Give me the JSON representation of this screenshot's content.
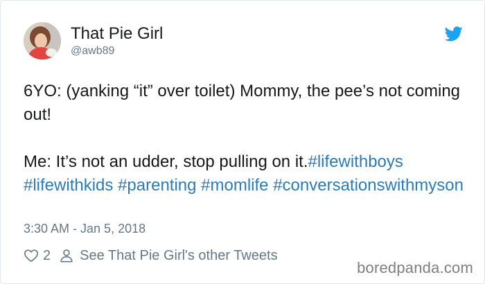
{
  "user": {
    "display_name": "That Pie Girl",
    "handle": "@awb89"
  },
  "tweet": {
    "line1": "6YO: (yanking “it” over toilet) Mommy, the pee’s not coming out!",
    "line2": "Me: It’s not an udder, stop pulling on it.",
    "hashtags": [
      "#lifewithboys",
      "#lifewithkids",
      "#parenting",
      "#momlife",
      "#conversationswithmyson"
    ],
    "timestamp": "3:30 AM - Jan 5, 2018"
  },
  "actions": {
    "like_count": "2",
    "other_tweets_label": "See That Pie Girl's other Tweets"
  },
  "watermark": "boredpanda.com",
  "colors": {
    "text": "#14171a",
    "secondary": "#657786",
    "hashtag": "#2b7bb9",
    "twitter_blue": "#1da1f2"
  },
  "icons": {
    "brand": "twitter-bird-icon",
    "like": "heart-icon",
    "profile": "person-icon"
  }
}
